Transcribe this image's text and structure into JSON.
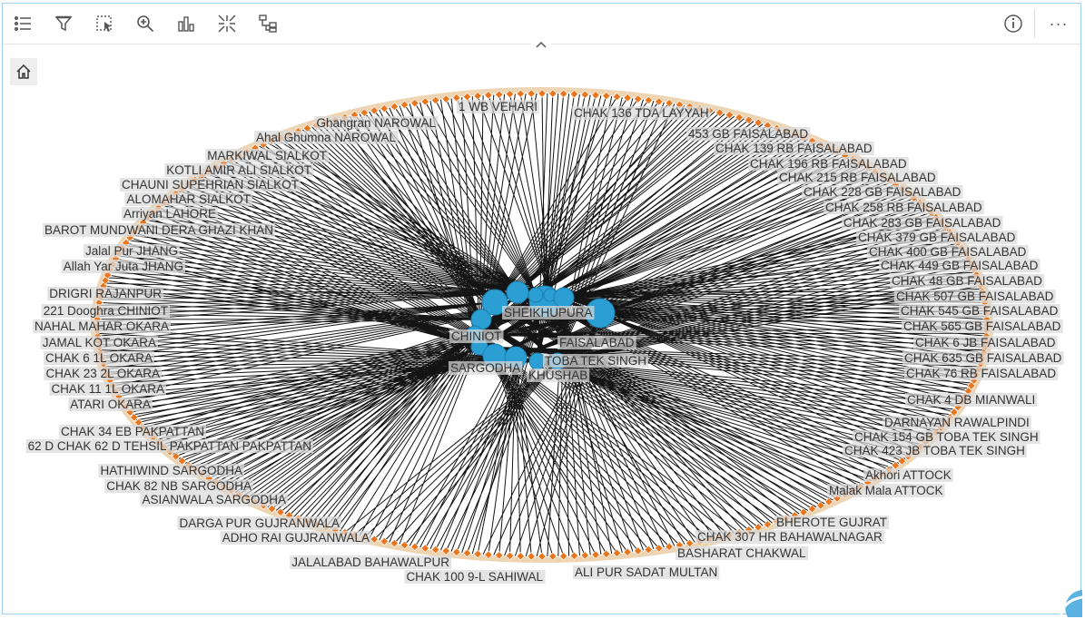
{
  "toolbar": {
    "left_icons": [
      "legend-icon",
      "filter-icon",
      "selection-icon",
      "zoom-icon",
      "chart-icon",
      "collapse-icon",
      "layout-icon"
    ],
    "right_icons": [
      "info-icon",
      "more-icon"
    ],
    "more_label": "···"
  },
  "home_icon": "home-icon",
  "colors": {
    "center_node": "#2b9fd4",
    "leaf_node": "#e8761e",
    "ring_halo": "#e9c9a0",
    "edge": "#000000",
    "frame": "#9fd0ee"
  },
  "center_nodes": [
    "SHEIKHUPURA",
    "CHINIOT",
    "FAISALABAD",
    "SARGODHA",
    "TOBA TEK SINGH",
    "KHUSHAB"
  ],
  "leaf_labels": [
    "1 WB VEHARI",
    "CHAK 136 TDA LAYYAH",
    "Ghangran NAROWAL",
    "Ahal Ghumna NAROWAL",
    "453 GB FAISALABAD",
    "CHAK 139 RB FAISALABAD",
    "MARKIWAL SIALKOT",
    "KOTLI AMIR ALI SIALKOT",
    "CHAK 196 RB FAISALABAD",
    "CHAUNI SUPEHRIAN SIALKOT",
    "CHAK 215 RB FAISALABAD",
    "ALOMAHAR SIALKOT",
    "CHAK 228 GB FAISALABAD",
    "Arriyan LAHORE",
    "CHAK 258 RB FAISALABAD",
    "CHAK 283 GB FAISALABAD",
    "BAROT MUNDWANI DERA GHAZI KHAN",
    "CHAK 379 GB FAISALABAD",
    "Jalal Pur JHANG",
    "CHAK 400 GB FAISALABAD",
    "Allah Yar Juta JHANG",
    "CHAK 449 GB FAISALABAD",
    "CHAK 48 GB FAISALABAD",
    "DRIGRI RAJANPUR",
    "CHAK 507 GB FAISALABAD",
    "221 Dooghra CHINIOT",
    "CHAK 545 GB FAISALABAD",
    "NAHAL MAHAR OKARA",
    "CHAK 565 GB FAISALABAD",
    "JAMAL KOT OKARA",
    "CHAK 6 JB FAISALABAD",
    "CHAK 6 1L OKARA",
    "CHAK 635 GB FAISALABAD",
    "CHAK 23 2L OKARA",
    "CHAK 76 RB FAISALABAD",
    "CHAK 11 1L OKARA",
    "CHAK 4 DB MIANWALI",
    "ATARI OKARA",
    "DARNAYAN RAWALPINDI",
    "CHAK 34 EB PAKPATTAN",
    "CHAK 154 GB TOBA TEK SINGH",
    "62 D CHAK 62 D TEHSIL PAKPATTAN PAKPATTAN",
    "CHAK 423 JB TOBA TEK SINGH",
    "HATHIWIND SARGODHA",
    "Akhori ATTOCK",
    "CHAK 82 NB SARGODHA",
    "Malak Mala ATTOCK",
    "ASIANWALA SARGODHA",
    "BHEROTE GUJRAT",
    "DARGA PUR GUJRANWALA",
    "CHAK 307 HR BAHAWALNAGAR",
    "ADHO RAI GUJRANWALA",
    "BASHARAT CHAKWAL",
    "JALALABAD BAHAWALPUR",
    "ALI PUR SADAT MULTAN",
    "CHAK 100 9-L SAHIWAL"
  ]
}
